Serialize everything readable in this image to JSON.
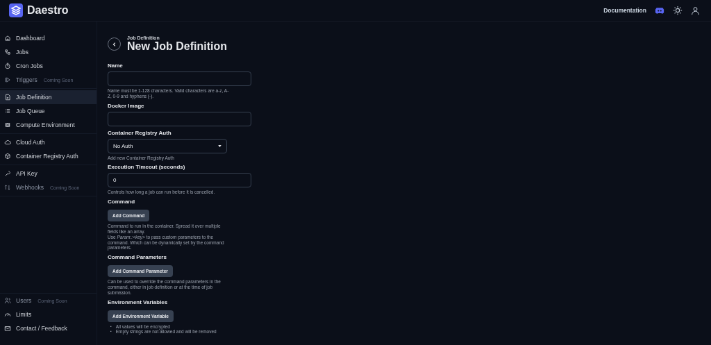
{
  "header": {
    "brand": "Daestro",
    "documentation_link": "Documentation"
  },
  "sidebar": {
    "groups": [
      [
        {
          "label": "Dashboard",
          "selected": false
        },
        {
          "label": "Jobs",
          "selected": false
        },
        {
          "label": "Cron Jobs",
          "selected": false
        },
        {
          "label": "Triggers",
          "badge": "Coming Soon",
          "selected": false
        }
      ],
      [
        {
          "label": "Job Definition",
          "selected": true
        },
        {
          "label": "Job Queue",
          "selected": false
        },
        {
          "label": "Compute Environment",
          "selected": false
        }
      ],
      [
        {
          "label": "Cloud Auth",
          "selected": false
        },
        {
          "label": "Container Registry Auth",
          "selected": false
        }
      ],
      [
        {
          "label": "API Key",
          "selected": false
        },
        {
          "label": "Webhooks",
          "badge": "Coming Soon",
          "selected": false
        }
      ]
    ],
    "bottom_items": [
      {
        "label": "Users",
        "badge": "Coming Soon",
        "selected": false
      },
      {
        "label": "Limits",
        "selected": false
      },
      {
        "label": "Contact / Feedback",
        "selected": false
      }
    ]
  },
  "page": {
    "breadcrumb": "Job Definition",
    "title": "New Job Definition"
  },
  "form": [
    {
      "kind": "text",
      "label": "Name",
      "help": "Name must be 1-128 characters. Valid characters are a-z, A-Z, 0-9 and hyphens (-)."
    },
    {
      "kind": "text",
      "label": "Docker Image"
    },
    {
      "kind": "select",
      "label": "Container Registry Auth",
      "value": "No Auth",
      "help": "Add new Container Registry Auth"
    },
    {
      "kind": "text",
      "label": "Execution Timeout (seconds)",
      "value": "0",
      "help": "Controls how long a job can run before it is cancelled."
    },
    {
      "kind": "button",
      "label": "Command",
      "button": "Add Command",
      "help": "Command to run in the container. Spread it over multiple fields like an array.\nUse *Param::<key>* to pass custom parameters to the command. Which can be dynamically set by the command parameters."
    },
    {
      "kind": "button",
      "label": "Command Parameters",
      "button": "Add Command Parameter",
      "help": "Can be used to override the command parameters in the command, either in job definition or at the time of job submission."
    },
    {
      "kind": "button",
      "label": "Environment Variables",
      "button": "Add Environment Variable",
      "bullets": [
        {
          "marker": "▪",
          "text": "All values will be encrypted"
        },
        {
          "marker": "▪",
          "text": "Empty strings are not allowed and will be removed"
        }
      ]
    }
  ]
}
